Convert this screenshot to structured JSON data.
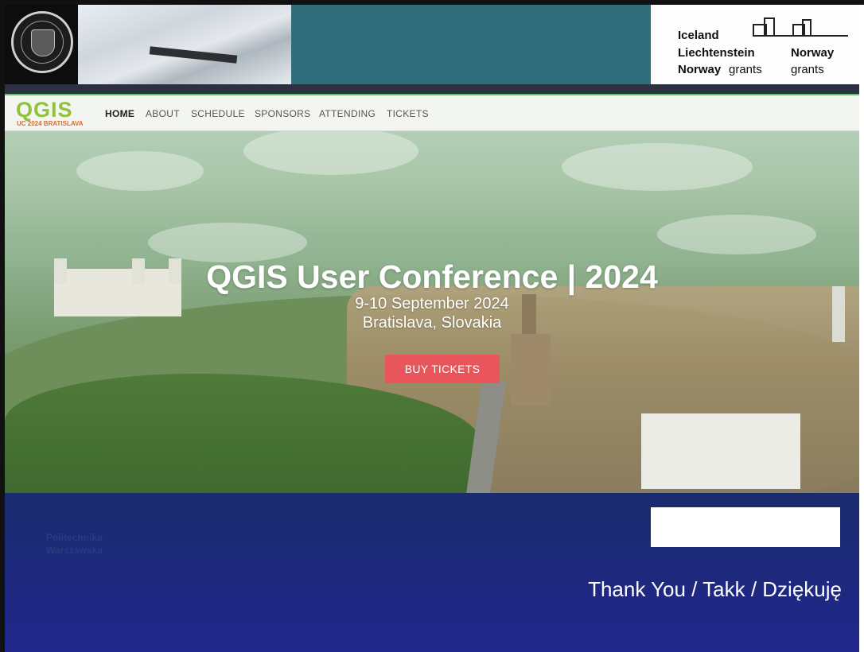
{
  "header": {
    "seal_text": "POLITECHNIKA WARSZAWSKA WARSAW UNIVERSITY OF TECHNOLOGY",
    "grants": {
      "line1": "Iceland",
      "line2a": "Liechtenstein",
      "line2b": "Norway",
      "line3a_bold": "Norway",
      "line3a": "grants",
      "line3b": "grants"
    }
  },
  "site": {
    "logo_text": "QGIS",
    "logo_sub": "UC 2024 BRATISLAVA",
    "nav": [
      "HOME",
      "ABOUT",
      "SCHEDULE",
      "SPONSORS",
      "ATTENDING",
      "TICKETS"
    ],
    "hero_title": "QGIS User Conference | 2024",
    "hero_date": "9-10 September 2024",
    "hero_location": "Bratislava, Slovakia",
    "buy_button": "BUY TICKETS"
  },
  "footer": {
    "pw_line1": "Politechnika",
    "pw_line2": "Warszawska",
    "thanks": "Thank You / Takk / Dziękuję"
  },
  "colors": {
    "accent_button": "#e8555a",
    "header_teal": "#2f6e7a",
    "footer_navy": "#21278c",
    "logo_green": "#8fc23a"
  }
}
